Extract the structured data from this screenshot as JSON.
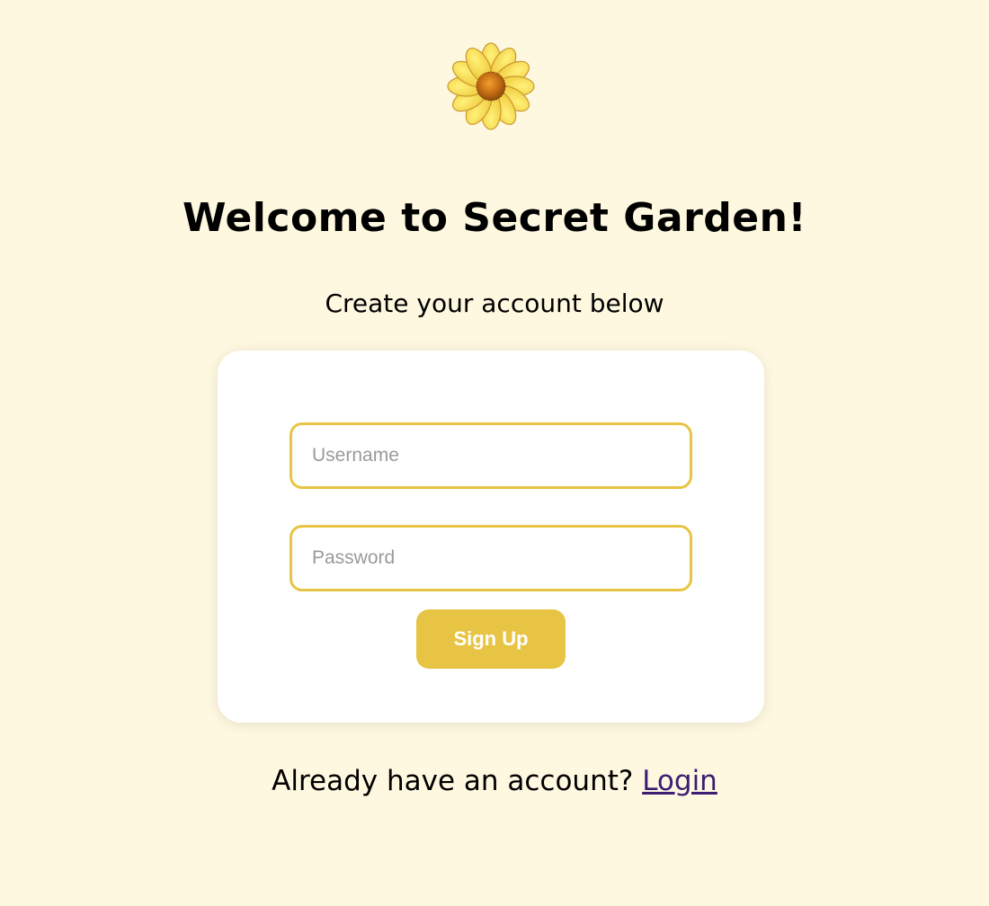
{
  "logo": {
    "icon": "daisy-flower-icon"
  },
  "header": {
    "title": "Welcome to Secret Garden!",
    "subtitle": "Create your account below"
  },
  "form": {
    "username_placeholder": "Username",
    "password_placeholder": "Password",
    "submit_label": "Sign Up"
  },
  "footer": {
    "prompt": "Already have an account?",
    "login_label": "Login"
  },
  "colors": {
    "background": "#fff8e0",
    "accent": "#e8c444",
    "link": "#3b1d72"
  }
}
